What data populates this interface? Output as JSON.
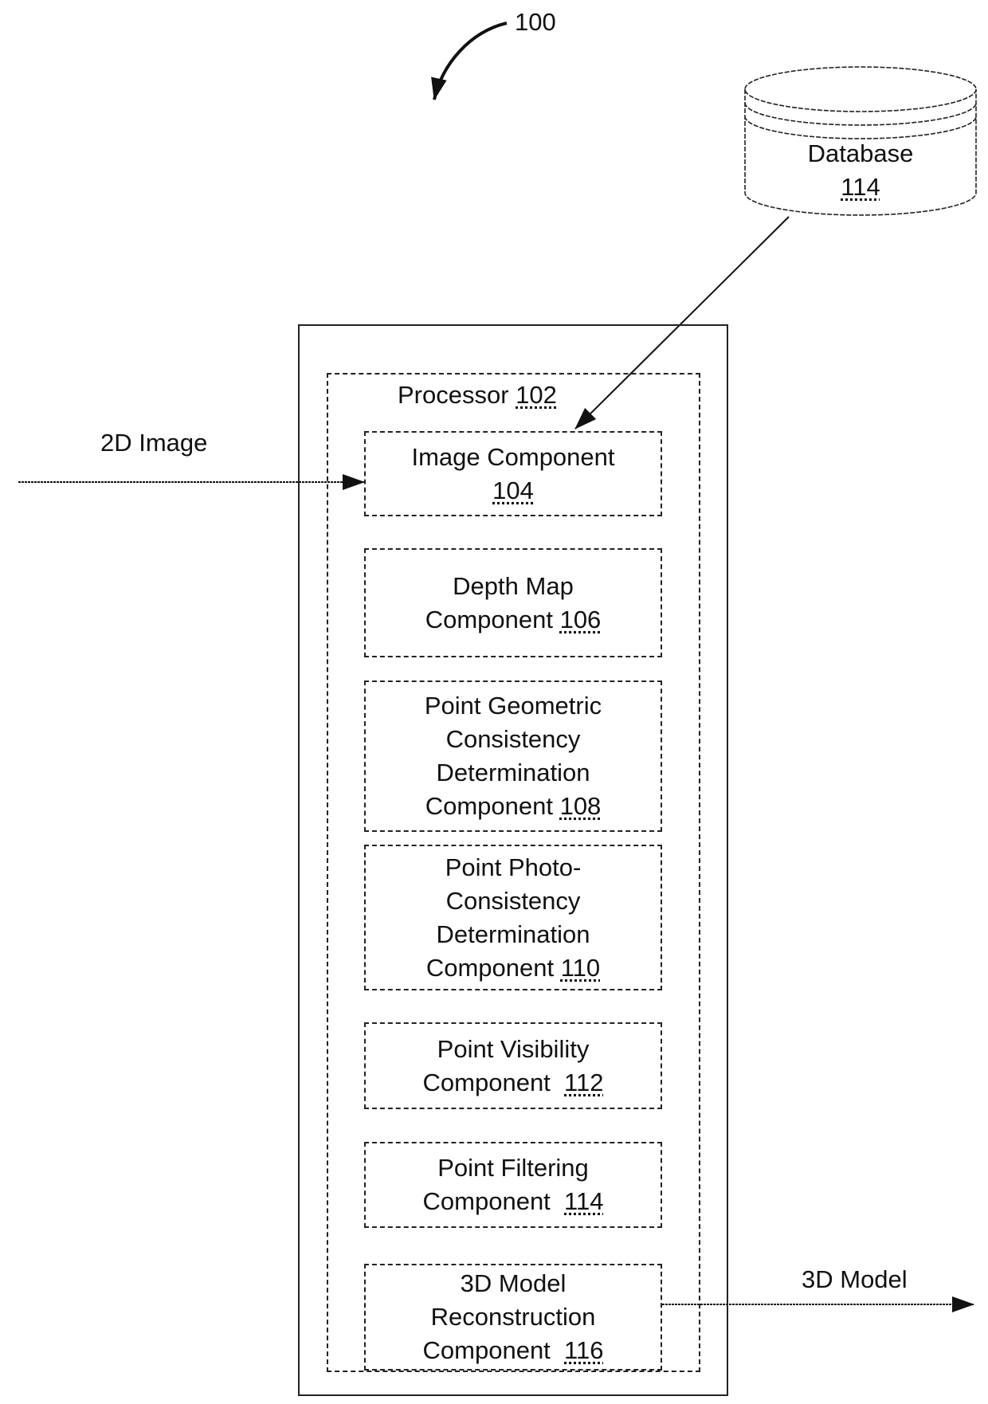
{
  "figure": {
    "reference_numeral": "100"
  },
  "database": {
    "title": "Database",
    "ref": "114"
  },
  "processor": {
    "title": "Processor",
    "ref": "102"
  },
  "inputs": {
    "input_label": "2D Image",
    "output_label": "3D Model"
  },
  "components": [
    {
      "lines": [
        "Image Component"
      ],
      "prefix": "",
      "ref": "104"
    },
    {
      "lines": [
        "Depth Map"
      ],
      "prefix": "Component ",
      "ref": "106"
    },
    {
      "lines": [
        "Point Geometric",
        "Consistency",
        "Determination"
      ],
      "prefix": "Component ",
      "ref": "108"
    },
    {
      "lines": [
        "Point Photo-",
        "Consistency",
        "Determination"
      ],
      "prefix": "Component ",
      "ref": "110"
    },
    {
      "lines": [
        "Point Visibility"
      ],
      "prefix": "Component  ",
      "ref": "112"
    },
    {
      "lines": [
        "Point Filtering"
      ],
      "prefix": "Component  ",
      "ref": "114"
    },
    {
      "lines": [
        "3D Model",
        "Reconstruction"
      ],
      "prefix": "Component  ",
      "ref": "116"
    }
  ]
}
